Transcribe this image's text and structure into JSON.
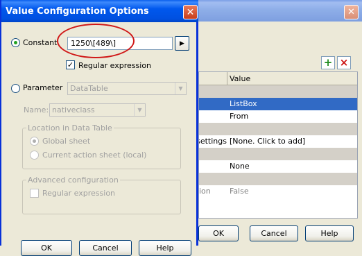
{
  "background_window": {
    "grid": {
      "value_header": "Value",
      "rows": [
        {
          "name": "",
          "value": "",
          "type": "cat"
        },
        {
          "name": "",
          "value": "ListBox",
          "type": "sel"
        },
        {
          "name": "",
          "value": "From",
          "type": "normal"
        },
        {
          "name": "",
          "value": "",
          "type": "cat"
        },
        {
          "name": "settings",
          "value": "[None. Click to add]",
          "type": "normal"
        },
        {
          "name": "",
          "value": "",
          "type": "cat"
        },
        {
          "name": "",
          "value": "None",
          "type": "normal"
        },
        {
          "name": "",
          "value": "",
          "type": "cat"
        },
        {
          "name": "ion",
          "value": "False",
          "type": "dim"
        }
      ]
    },
    "buttons": {
      "ok": "OK",
      "cancel": "Cancel",
      "help": "Help"
    },
    "icons": {
      "add": "+",
      "delete": "×"
    }
  },
  "dialog": {
    "title": "Value Configuration Options",
    "constant": {
      "label": "Constant",
      "value": "1250\\[489\\]",
      "regex_label": "Regular expression",
      "regex_checked": true
    },
    "parameter": {
      "label": "Parameter",
      "type_value": "DataTable",
      "name_label": "Name:",
      "name_value": "nativeclass",
      "location_group": "Location in Data Table",
      "global_sheet": "Global sheet",
      "current_sheet": "Current action sheet (local)",
      "advanced_group": "Advanced configuration",
      "advanced_regex": "Regular expression"
    },
    "buttons": {
      "ok": "OK",
      "cancel": "Cancel",
      "help": "Help"
    }
  },
  "colors": {
    "title_blue": "#0054e3",
    "selection": "#316ac5",
    "highlight_ellipse": "#d01818"
  }
}
